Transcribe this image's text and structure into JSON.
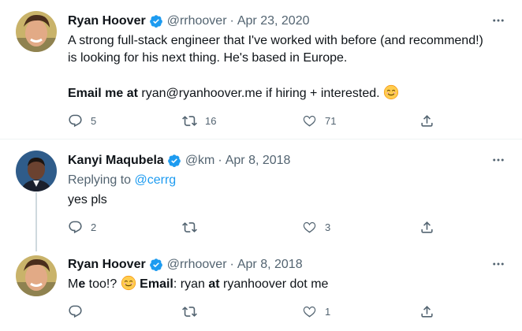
{
  "tweets": [
    {
      "author_name": "Ryan Hoover",
      "handle": "@rrhoover",
      "separator": "·",
      "date": "Apr 23, 2020",
      "line1": "A strong full-stack engineer that I've worked with before (and recommend!)",
      "line2": "is looking for his next thing. He's based in Europe.",
      "bold_prefix": "Email me at",
      "line3_rest": " ryan@ryanhoover.me if hiring + interested. ",
      "emoji": "smiling-face-emoji",
      "reply_count": "5",
      "retweet_count": "16",
      "like_count": "71"
    },
    {
      "author_name": "Kanyi Maqubela",
      "handle": "@km",
      "separator": "·",
      "date": "Apr 8, 2018",
      "replying_to_label": "Replying to",
      "replying_to_handle": "@cerrg",
      "body": "yes pls",
      "reply_count": "2",
      "retweet_count": "",
      "like_count": "3"
    },
    {
      "author_name": "Ryan Hoover",
      "handle": "@rrhoover",
      "separator": "·",
      "date": "Apr 8, 2018",
      "part1_m": "M",
      "part1_e": "e",
      "part1_rest": " too!? ",
      "email_label": "Email",
      "part2": ": ryan ",
      "at_word": "at",
      "part3": " ryanhoover dot me",
      "reply_count": "",
      "retweet_count": "",
      "like_count": "1"
    }
  ],
  "colors": {
    "text": "#0f1419",
    "secondary": "#536471",
    "accent": "#1d9bf0",
    "line": "#cfd9de"
  }
}
